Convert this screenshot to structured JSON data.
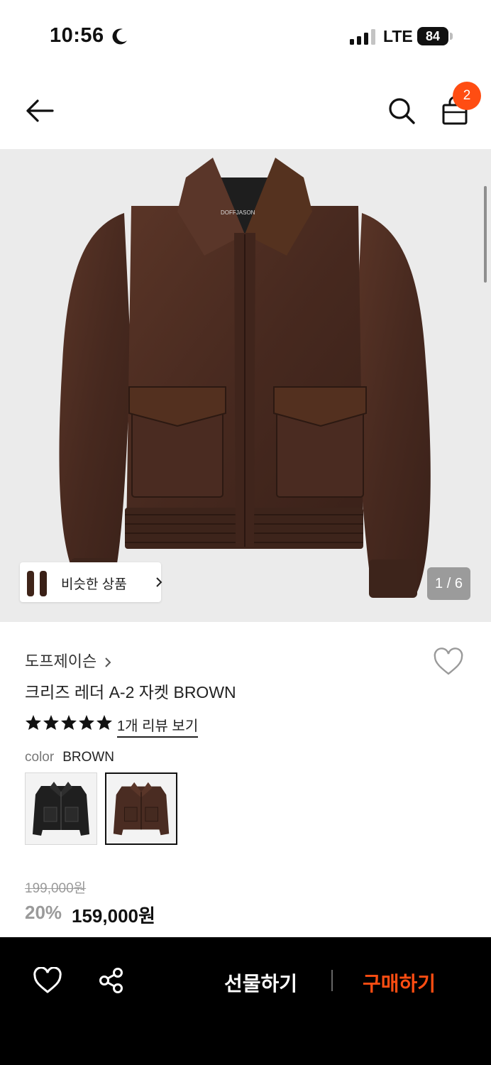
{
  "status_bar": {
    "time": "10:56",
    "network": "LTE",
    "battery": "84"
  },
  "nav": {
    "cart_count": "2",
    "icons": [
      "back-arrow-icon",
      "search-icon",
      "shopping-bag-icon"
    ]
  },
  "gallery": {
    "similar_label": "비슷한 상품",
    "page_counter": "1 / 6"
  },
  "product": {
    "brand": "도프제이슨",
    "title": "크리즈 레더 A-2 자켓 BROWN",
    "rating": 5,
    "review_link": "1개 리뷰 보기",
    "color_key": "color",
    "color_value": "BROWN",
    "swatches": [
      {
        "color": "black",
        "selected": false
      },
      {
        "color": "brown",
        "selected": true
      }
    ],
    "original_price": "199,000원",
    "discount": "20%",
    "sale_price": "159,000원"
  },
  "bottom_bar": {
    "gift_label": "선물하기",
    "buy_label": "구매하기"
  },
  "colors": {
    "accent": "#ff4d12",
    "jacket_brown": "#4a2c22",
    "bottom_bar_bg": "#000000"
  }
}
